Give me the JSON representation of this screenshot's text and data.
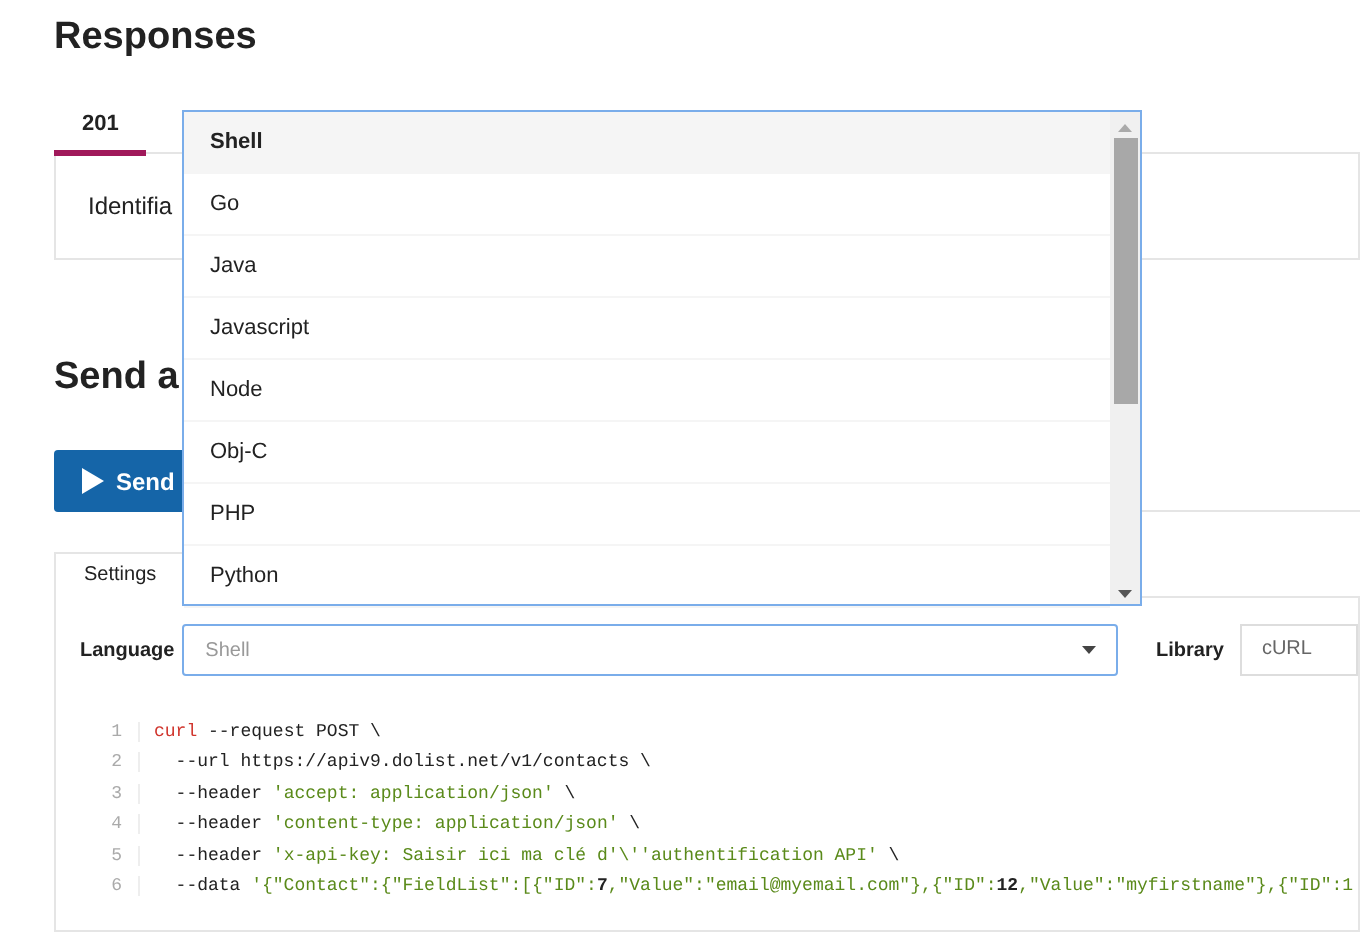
{
  "responses": {
    "title": "Responses",
    "tabs": [
      {
        "label": "201",
        "selected": true
      }
    ],
    "body_text": "Identifia"
  },
  "send": {
    "title": "Send a",
    "button": "Send"
  },
  "settings": {
    "tabs": [
      {
        "label": "Settings",
        "selected": true
      }
    ],
    "language_label": "Language",
    "language_value": "Shell",
    "library_label": "Library",
    "library_value": "cURL"
  },
  "dropdown": {
    "items": [
      {
        "label": "Shell",
        "selected": true
      },
      {
        "label": "Go",
        "selected": false
      },
      {
        "label": "Java",
        "selected": false
      },
      {
        "label": "Javascript",
        "selected": false
      },
      {
        "label": "Node",
        "selected": false
      },
      {
        "label": "Obj-C",
        "selected": false
      },
      {
        "label": "PHP",
        "selected": false
      },
      {
        "label": "Python",
        "selected": false
      }
    ]
  },
  "code": {
    "lines": [
      {
        "number": "1",
        "segments": [
          {
            "kind": "cmd",
            "text": "curl"
          },
          {
            "kind": "plain",
            "text": " --request POST \\"
          }
        ]
      },
      {
        "number": "2",
        "segments": [
          {
            "kind": "plain",
            "text": "  --url https://apiv9.dolist.net/v1/contacts \\"
          }
        ]
      },
      {
        "number": "3",
        "segments": [
          {
            "kind": "plain",
            "text": "  --header "
          },
          {
            "kind": "str",
            "text": "'accept: application/json'"
          },
          {
            "kind": "plain",
            "text": " \\"
          }
        ]
      },
      {
        "number": "4",
        "segments": [
          {
            "kind": "plain",
            "text": "  --header "
          },
          {
            "kind": "str",
            "text": "'content-type: application/json'"
          },
          {
            "kind": "plain",
            "text": " \\"
          }
        ]
      },
      {
        "number": "5",
        "segments": [
          {
            "kind": "plain",
            "text": "  --header "
          },
          {
            "kind": "str",
            "text": "'x-api-key: Saisir ici ma clé d'\\''authentification API'"
          },
          {
            "kind": "plain",
            "text": " \\"
          }
        ]
      },
      {
        "number": "6",
        "segments": [
          {
            "kind": "plain",
            "text": "  --data "
          },
          {
            "kind": "str",
            "text": "'{\"Contact\":{\"FieldList\":[{\"ID\":"
          },
          {
            "kind": "num",
            "text": "7"
          },
          {
            "kind": "str",
            "text": ",\"Value\":\"email@myemail.com\"},{\"ID\":"
          },
          {
            "kind": "num",
            "text": "12"
          },
          {
            "kind": "str",
            "text": ",\"Value\":\"myfirstname\"},{\"ID\":1"
          }
        ]
      }
    ]
  }
}
